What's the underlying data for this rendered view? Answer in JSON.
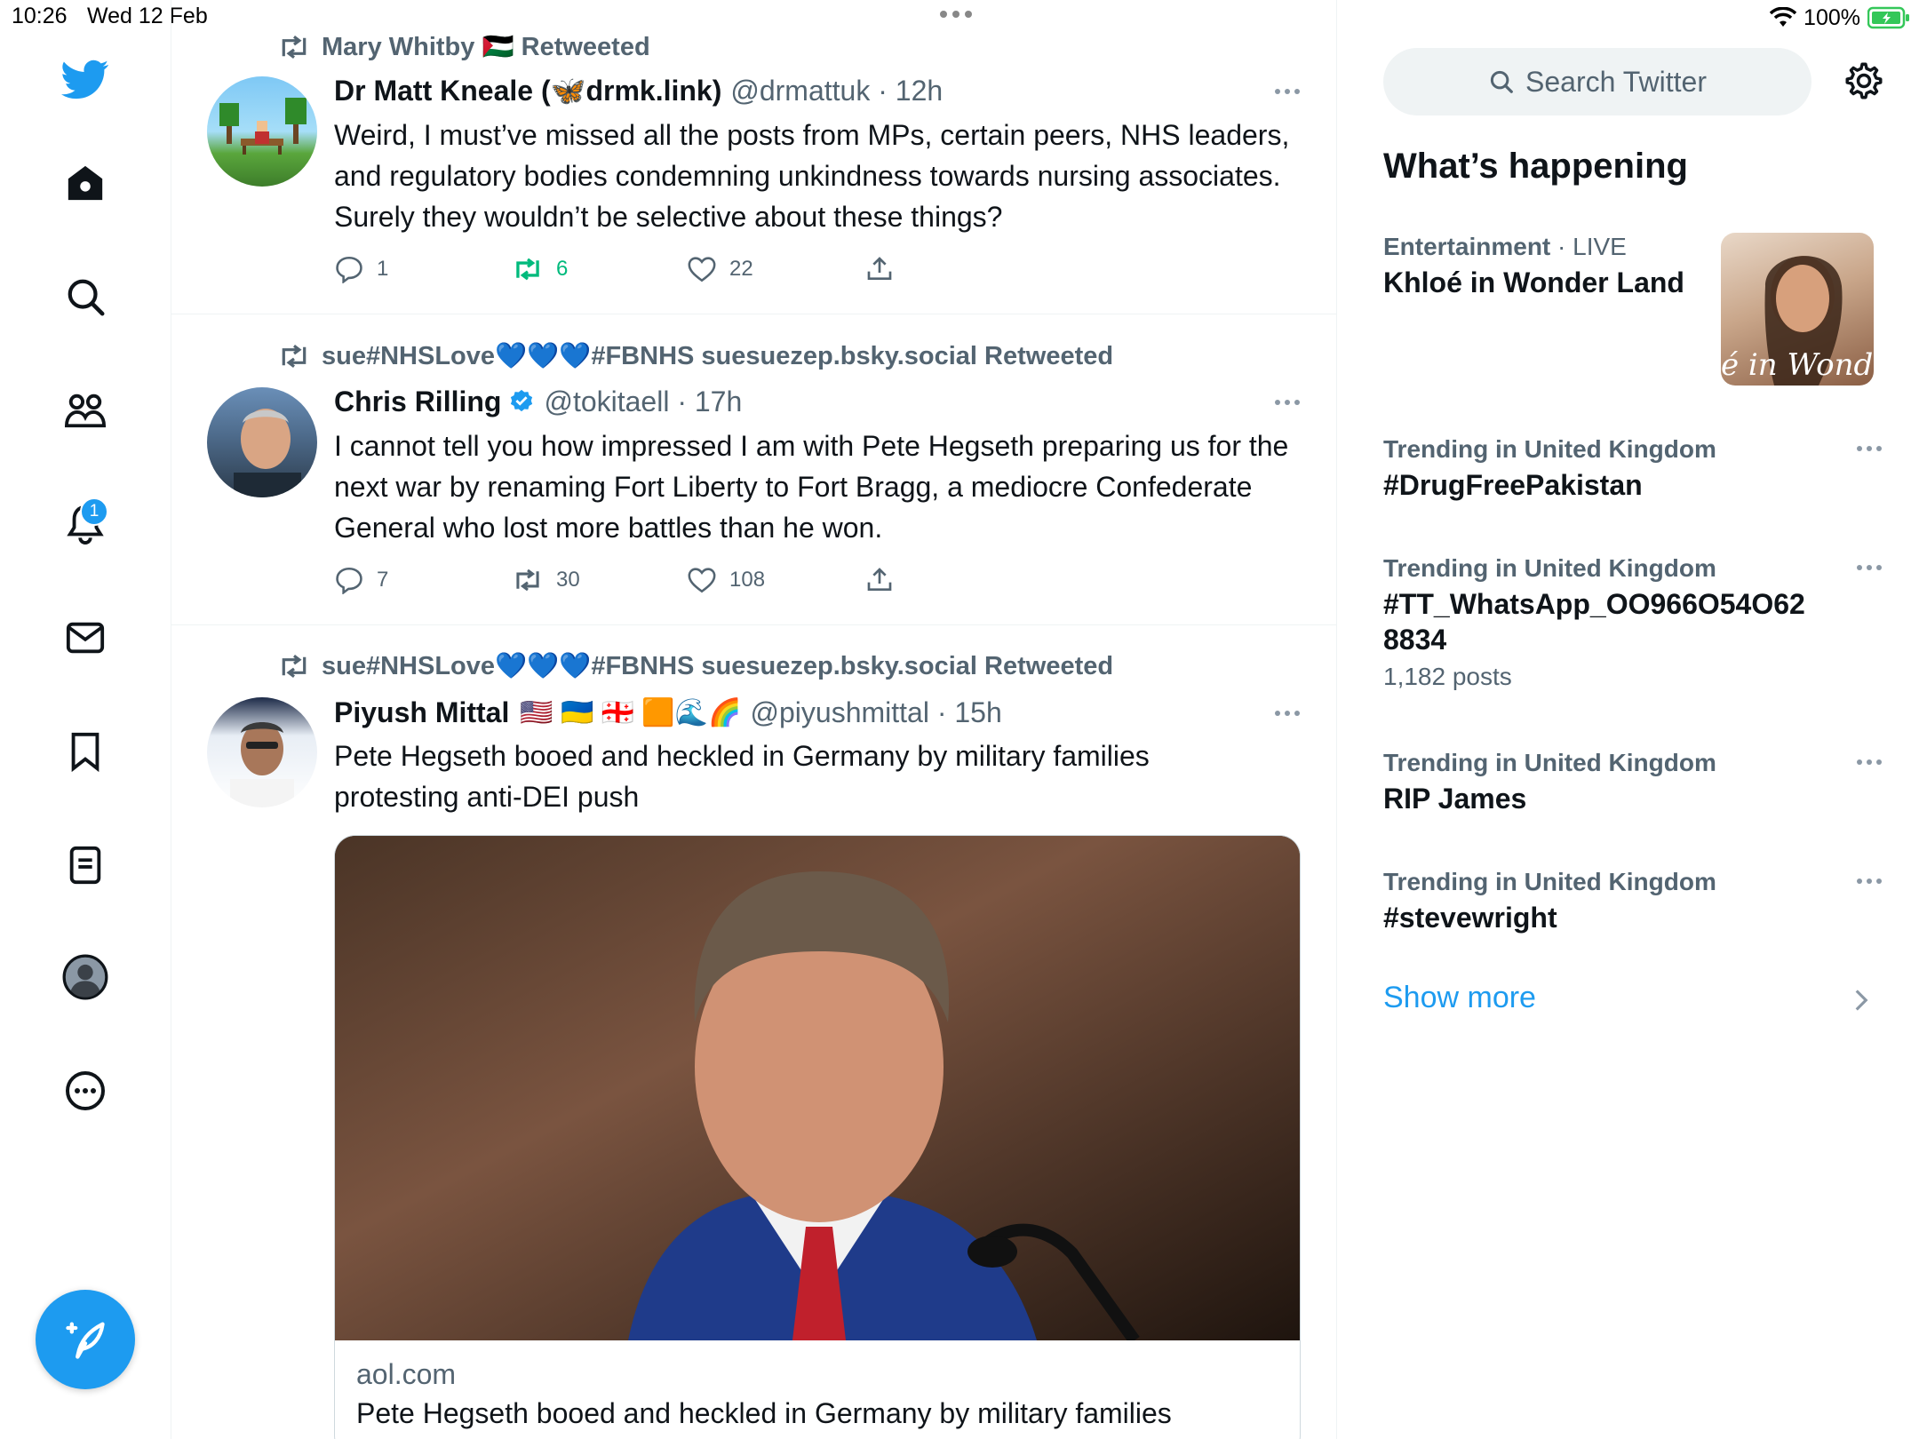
{
  "status": {
    "time": "10:26",
    "date": "Wed 12 Feb",
    "battery": "100%"
  },
  "nav": {
    "items": [
      "twitter-logo",
      "home",
      "explore",
      "communities",
      "notifications",
      "messages",
      "bookmarks",
      "lists",
      "profile",
      "more"
    ],
    "notification_count": "1"
  },
  "tweets": [
    {
      "retweeted_by": "Mary Whitby 🇵🇸 Retweeted",
      "name": "Dr Matt Kneale (🦋drmk.link)",
      "handle": "@drmattuk · 12h",
      "text": "Weird, I must’ve missed all the posts from MPs, certain peers, NHS leaders, and regulatory bodies condemning unkindness towards nursing associates. Surely they wouldn’t be selective about these things?",
      "replies": "1",
      "retweets": "6",
      "likes": "22"
    },
    {
      "retweeted_by": "sue#NHSLove💙💙💙#FBNHS suesuezep.bsky.social Retweeted",
      "name": "Chris Rilling",
      "handle": "@tokitaell · 17h",
      "text": "I cannot tell you how impressed I am with Pete Hegseth preparing us for the next war by renaming Fort Liberty to Fort Bragg, a mediocre Confederate General who lost more battles than he won.",
      "replies": "7",
      "retweets": "30",
      "likes": "108"
    },
    {
      "retweeted_by": "sue#NHSLove💙💙💙#FBNHS suesuezep.bsky.social Retweeted",
      "name": "Piyush Mittal",
      "flags": "🇺🇸 🇺🇦 🇬🇪 🟧🌊🌈",
      "handle": "@piyushmittal · 15h",
      "text": "Pete Hegseth booed and heckled in Germany by military families protesting anti-DEI push",
      "card": {
        "domain": "aol.com",
        "title": "Pete Hegseth booed and heckled in Germany by military families"
      }
    }
  ],
  "right": {
    "search_placeholder": "Search Twitter",
    "whats_happening": "What’s happening",
    "trends": [
      {
        "category": "Entertainment",
        "live": "· LIVE",
        "name": "Khloé in Wonder Land"
      },
      {
        "category": "Trending in United Kingdom",
        "name": "#DrugFreePakistan"
      },
      {
        "category": "Trending in United Kingdom",
        "name": "#TT_WhatsApp_OO966O54O62 8834",
        "posts": "1,182 posts"
      },
      {
        "category": "Trending in United Kingdom",
        "name": "RIP James"
      },
      {
        "category": "Trending in United Kingdom",
        "name": "#stevewright"
      }
    ],
    "show_more": "Show more"
  },
  "colors": {
    "accent": "#1d9bf0",
    "retweet_green": "#00ba7c",
    "muted": "#536471"
  }
}
